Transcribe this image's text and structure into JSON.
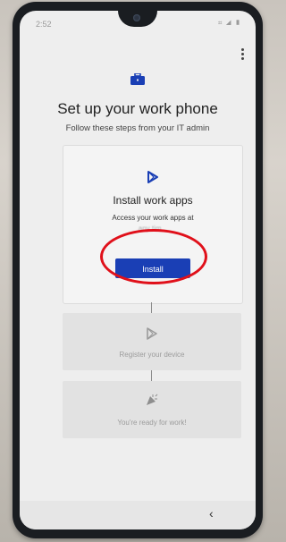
{
  "status": {
    "time": "2:52",
    "icons": "⌗ ◢ ▮"
  },
  "header": {
    "title": "Set up your work phone",
    "subtitle": "Follow these steps from your IT admin"
  },
  "steps": [
    {
      "title": "Install work apps",
      "description": "Access your work apps at",
      "description_obscured": "any tim...",
      "button_label": "Install",
      "icon": "play-store-icon",
      "active": true
    },
    {
      "label": "Register your device",
      "icon": "play-store-icon",
      "active": false
    },
    {
      "label": "You're ready for work!",
      "icon": "celebrate-icon",
      "active": false
    }
  ],
  "navbar": {
    "back_glyph": "‹"
  },
  "colors": {
    "accent": "#1a3fb5",
    "annotation": "#e0101a",
    "screen_bg": "#eeeeee"
  }
}
